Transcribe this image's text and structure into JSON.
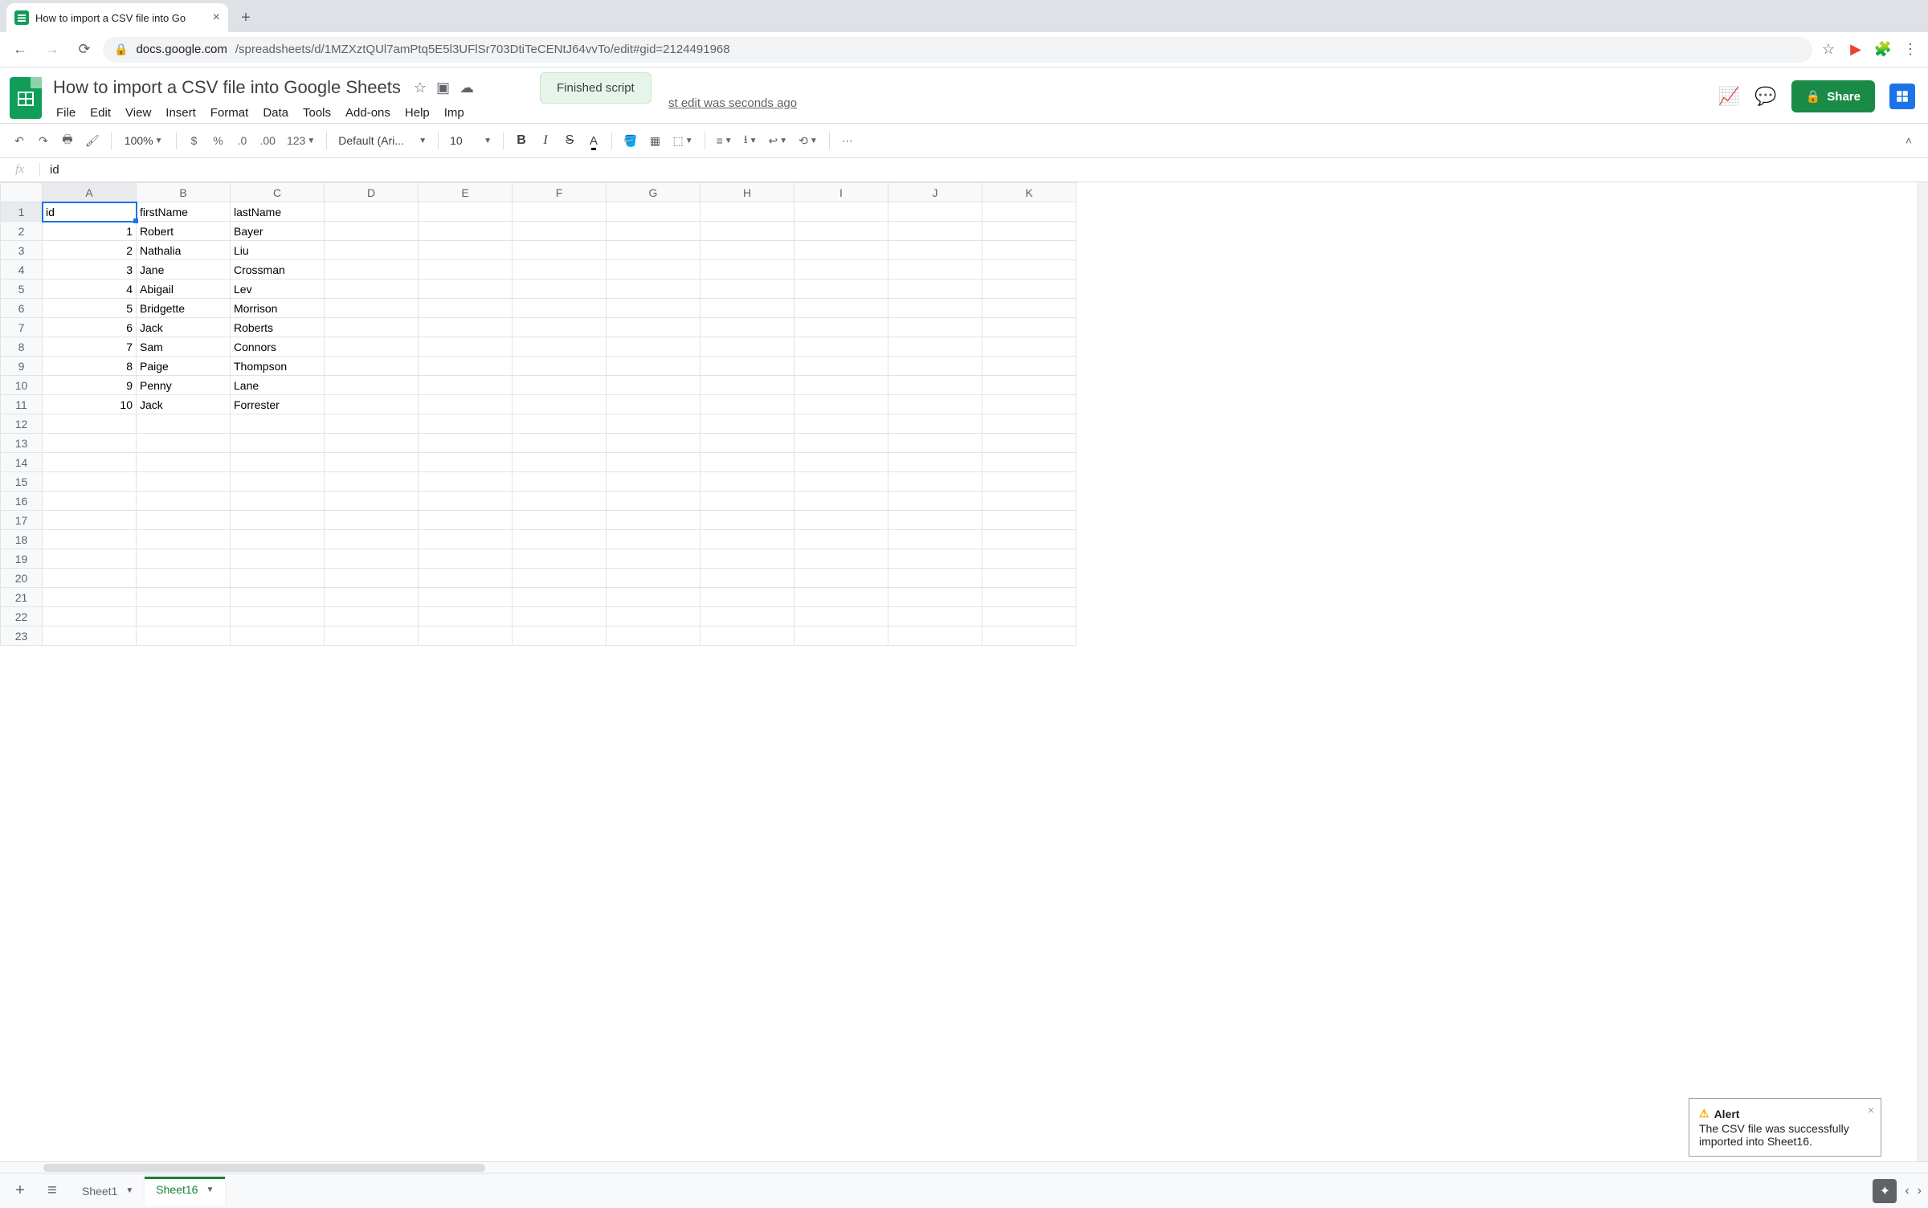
{
  "browser": {
    "tab_title": "How to import a CSV file into Go",
    "url_host": "docs.google.com",
    "url_path": "/spreadsheets/d/1MZXztQUl7amPtq5E5l3UFlSr703DtiTeCENtJ64vvTo/edit#gid=2124491968"
  },
  "doc": {
    "title": "How to import a CSV file into Google Sheets",
    "menus": [
      "File",
      "Edit",
      "View",
      "Insert",
      "Format",
      "Data",
      "Tools",
      "Add-ons",
      "Help",
      "Imp"
    ],
    "last_edit": "st edit was seconds ago",
    "toast": "Finished script",
    "share": "Share"
  },
  "toolbar": {
    "zoom": "100%",
    "font": "Default (Ari...",
    "font_size": "10"
  },
  "fx": {
    "value": "id"
  },
  "grid": {
    "cols": [
      "A",
      "B",
      "C",
      "D",
      "E",
      "F",
      "G",
      "H",
      "I",
      "J",
      "K"
    ],
    "row_count": 23,
    "selected": {
      "row": 1,
      "col": "A"
    },
    "rows": [
      {
        "A": "id",
        "B": "firstName",
        "C": "lastName"
      },
      {
        "A": "1",
        "B": "Robert",
        "C": "Bayer"
      },
      {
        "A": "2",
        "B": "Nathalia",
        "C": "Liu"
      },
      {
        "A": "3",
        "B": "Jane",
        "C": "Crossman"
      },
      {
        "A": "4",
        "B": "Abigail",
        "C": "Lev"
      },
      {
        "A": "5",
        "B": "Bridgette",
        "C": "Morrison"
      },
      {
        "A": "6",
        "B": "Jack",
        "C": "Roberts"
      },
      {
        "A": "7",
        "B": "Sam",
        "C": "Connors"
      },
      {
        "A": "8",
        "B": "Paige",
        "C": "Thompson"
      },
      {
        "A": "9",
        "B": "Penny",
        "C": "Lane"
      },
      {
        "A": "10",
        "B": "Jack",
        "C": "Forrester"
      }
    ]
  },
  "alert": {
    "title": "Alert",
    "body": "The CSV file was successfully imported into Sheet16."
  },
  "tabs": {
    "sheets": [
      "Sheet1",
      "Sheet16"
    ],
    "active": "Sheet16"
  }
}
